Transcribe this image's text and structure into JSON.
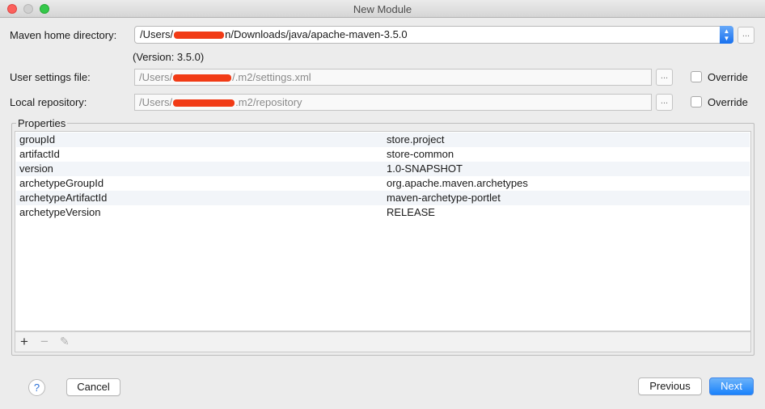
{
  "window": {
    "title": "New Module"
  },
  "maven_home": {
    "label": "Maven home directory:",
    "value_prefix": "/Users/",
    "value_suffix": "n/Downloads/java/apache-maven-3.5.0",
    "version_text": "(Version: 3.5.0)",
    "browse_label": "..."
  },
  "user_settings": {
    "label": "User settings file:",
    "value_prefix": "/Users/",
    "value_suffix": "/.m2/settings.xml",
    "browse_label": "...",
    "override_label": "Override"
  },
  "local_repo": {
    "label": "Local repository:",
    "value_prefix": "/Users/",
    "value_suffix": ".m2/repository",
    "browse_label": "...",
    "override_label": "Override"
  },
  "properties": {
    "title": "Properties",
    "rows": [
      {
        "key": "groupId",
        "value": "store.project"
      },
      {
        "key": "artifactId",
        "value": "store-common"
      },
      {
        "key": "version",
        "value": "1.0-SNAPSHOT"
      },
      {
        "key": "archetypeGroupId",
        "value": "org.apache.maven.archetypes"
      },
      {
        "key": "archetypeArtifactId",
        "value": "maven-archetype-portlet"
      },
      {
        "key": "archetypeVersion",
        "value": "RELEASE"
      }
    ],
    "toolbar": {
      "add": "+",
      "remove": "−",
      "edit": "✎"
    }
  },
  "footer": {
    "help": "?",
    "cancel": "Cancel",
    "previous": "Previous",
    "next": "Next"
  },
  "colors": {
    "accent": "#1a82fb",
    "redaction": "#f13b16",
    "row_alt": "#f2f5f9"
  }
}
